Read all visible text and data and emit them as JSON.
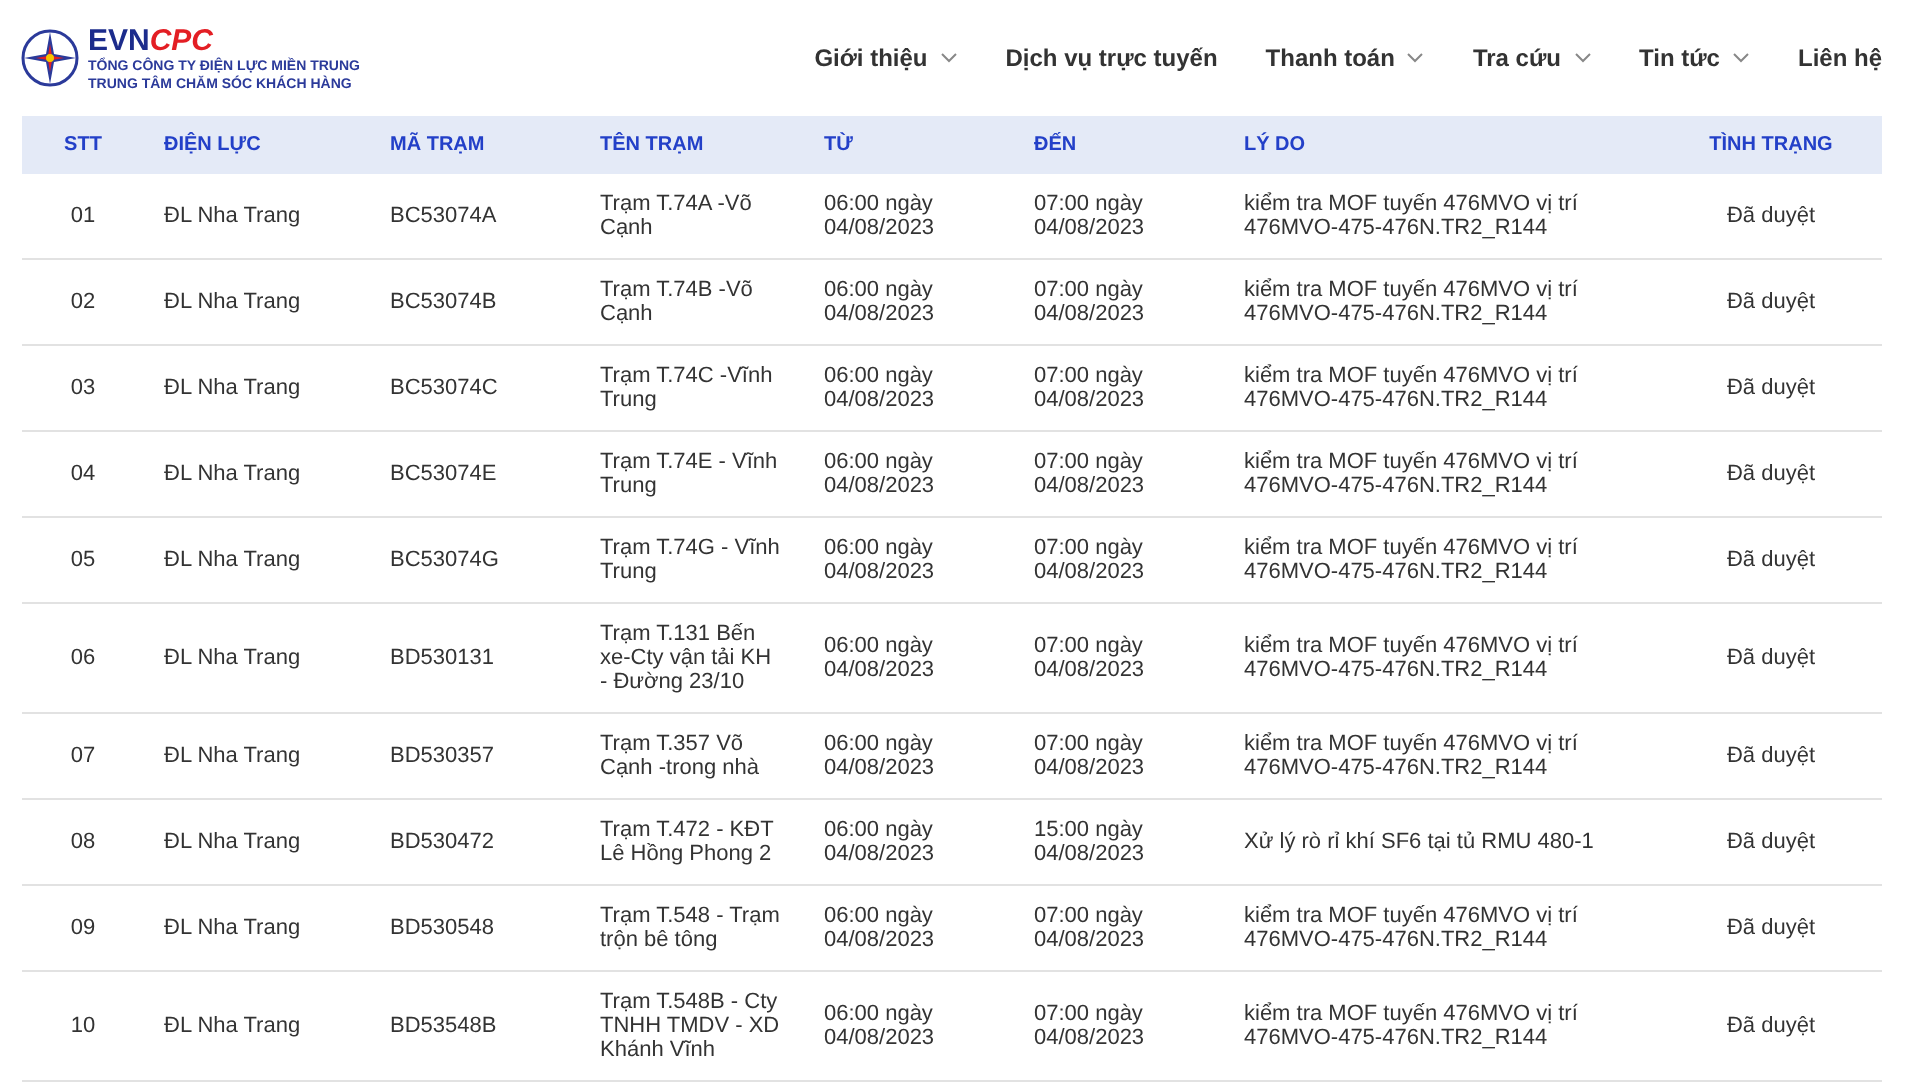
{
  "header": {
    "logo": {
      "brand_primary": "EVN",
      "brand_secondary": "CPC",
      "subtitle_lines": [
        "TỔNG CÔNG TY ĐIỆN LỰC MIỀN TRUNG",
        "TRUNG TÂM CHĂM SÓC KHÁCH HÀNG"
      ]
    },
    "nav": [
      {
        "label": "Giới thiệu",
        "has_dropdown": true
      },
      {
        "label": "Dịch vụ trực tuyến",
        "has_dropdown": false
      },
      {
        "label": "Thanh toán",
        "has_dropdown": true
      },
      {
        "label": "Tra cứu",
        "has_dropdown": true
      },
      {
        "label": "Tin tức",
        "has_dropdown": true
      },
      {
        "label": "Liên hệ",
        "has_dropdown": false
      }
    ]
  },
  "table": {
    "columns": [
      "STT",
      "ĐIỆN LỰC",
      "MÃ TRẠM",
      "TÊN TRẠM",
      "TỪ",
      "ĐẾN",
      "LÝ DO",
      "TÌNH TRẠNG"
    ],
    "rows": [
      {
        "stt": "01",
        "unit": "ĐL Nha Trang",
        "code": "BC53074A",
        "name": "Trạm T.74A -Võ Cạnh",
        "from": [
          "06:00 ngày",
          "04/08/2023"
        ],
        "to": [
          "07:00 ngày",
          "04/08/2023"
        ],
        "reason": "kiểm tra MOF tuyến 476MVO vị trí 476MVO-475-476N.TR2_R144",
        "status": "Đã duyệt"
      },
      {
        "stt": "02",
        "unit": "ĐL Nha Trang",
        "code": "BC53074B",
        "name": "Trạm T.74B -Võ Cạnh",
        "from": [
          "06:00 ngày",
          "04/08/2023"
        ],
        "to": [
          "07:00 ngày",
          "04/08/2023"
        ],
        "reason": "kiểm tra MOF tuyến 476MVO vị trí 476MVO-475-476N.TR2_R144",
        "status": "Đã duyệt"
      },
      {
        "stt": "03",
        "unit": "ĐL Nha Trang",
        "code": "BC53074C",
        "name": "Trạm T.74C -Vĩnh Trung",
        "from": [
          "06:00 ngày",
          "04/08/2023"
        ],
        "to": [
          "07:00 ngày",
          "04/08/2023"
        ],
        "reason": "kiểm tra MOF tuyến 476MVO vị trí 476MVO-475-476N.TR2_R144",
        "status": "Đã duyệt"
      },
      {
        "stt": "04",
        "unit": "ĐL Nha Trang",
        "code": "BC53074E",
        "name": "Trạm T.74E - Vĩnh Trung",
        "from": [
          "06:00 ngày",
          "04/08/2023"
        ],
        "to": [
          "07:00 ngày",
          "04/08/2023"
        ],
        "reason": "kiểm tra MOF tuyến 476MVO vị trí 476MVO-475-476N.TR2_R144",
        "status": "Đã duyệt"
      },
      {
        "stt": "05",
        "unit": "ĐL Nha Trang",
        "code": "BC53074G",
        "name": "Trạm T.74G - Vĩnh Trung",
        "from": [
          "06:00 ngày",
          "04/08/2023"
        ],
        "to": [
          "07:00 ngày",
          "04/08/2023"
        ],
        "reason": "kiểm tra MOF tuyến 476MVO vị trí 476MVO-475-476N.TR2_R144",
        "status": "Đã duyệt"
      },
      {
        "stt": "06",
        "unit": "ĐL Nha Trang",
        "code": "BD530131",
        "name": "Trạm T.131 Bến xe-Cty vận tải KH - Đường 23/10",
        "from": [
          "06:00 ngày",
          "04/08/2023"
        ],
        "to": [
          "07:00 ngày",
          "04/08/2023"
        ],
        "reason": "kiểm tra MOF tuyến 476MVO vị trí 476MVO-475-476N.TR2_R144",
        "status": "Đã duyệt"
      },
      {
        "stt": "07",
        "unit": "ĐL Nha Trang",
        "code": "BD530357",
        "name": "Trạm T.357 Võ Cạnh -trong nhà",
        "from": [
          "06:00 ngày",
          "04/08/2023"
        ],
        "to": [
          "07:00 ngày",
          "04/08/2023"
        ],
        "reason": "kiểm tra MOF tuyến 476MVO vị trí 476MVO-475-476N.TR2_R144",
        "status": "Đã duyệt"
      },
      {
        "stt": "08",
        "unit": "ĐL Nha Trang",
        "code": "BD530472",
        "name": "Trạm T.472 - KĐT Lê Hồng Phong 2",
        "from": [
          "06:00 ngày",
          "04/08/2023"
        ],
        "to": [
          "15:00 ngày",
          "04/08/2023"
        ],
        "reason": "Xử lý rò rỉ khí SF6 tại tủ RMU 480-1",
        "status": "Đã duyệt"
      },
      {
        "stt": "09",
        "unit": "ĐL Nha Trang",
        "code": "BD530548",
        "name": "Trạm T.548 - Trạm trộn bê tông",
        "from": [
          "06:00 ngày",
          "04/08/2023"
        ],
        "to": [
          "07:00 ngày",
          "04/08/2023"
        ],
        "reason": "kiểm tra MOF tuyến 476MVO vị trí 476MVO-475-476N.TR2_R144",
        "status": "Đã duyệt"
      },
      {
        "stt": "10",
        "unit": "ĐL Nha Trang",
        "code": "BD53548B",
        "name": "Trạm T.548B - Cty TNHH TMDV - XD Khánh Vĩnh",
        "from": [
          "06:00 ngày",
          "04/08/2023"
        ],
        "to": [
          "07:00 ngày",
          "04/08/2023"
        ],
        "reason": "kiểm tra MOF tuyến 476MVO vị trí 476MVO-475-476N.TR2_R144",
        "status": "Đã duyệt"
      }
    ]
  }
}
